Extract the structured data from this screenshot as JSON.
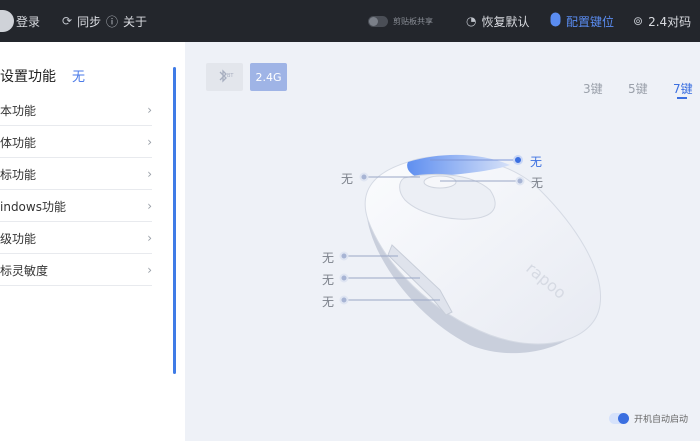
{
  "topbar": {
    "login": "登录",
    "sync": "同步",
    "about": "关于",
    "clipboard_share": "剪贴板共享",
    "restore_default": "恢复默认",
    "configure_keys": "配置键位",
    "pair_24g": "2.4对码"
  },
  "sidebar": {
    "title": "设置功能",
    "title_value": "无",
    "items": [
      {
        "label": "本功能"
      },
      {
        "label": "体功能"
      },
      {
        "label": "标功能"
      },
      {
        "label": "indows功能"
      },
      {
        "label": "级功能"
      },
      {
        "label": "标灵敏度"
      }
    ]
  },
  "modes": {
    "bluetooth": "BT",
    "g24": "2.4G"
  },
  "key_tabs": [
    "3键",
    "5键",
    "7键"
  ],
  "active_key_tab": "7键",
  "mouse_labels": {
    "top_button": "无",
    "right_button": "无",
    "left_button": "无",
    "side1": "无",
    "side2": "无",
    "side3": "无"
  },
  "brand": "rapoo",
  "autostart": "开机自动启动",
  "colors": {
    "accent": "#3b6fe0",
    "topbar": "#23262c"
  }
}
